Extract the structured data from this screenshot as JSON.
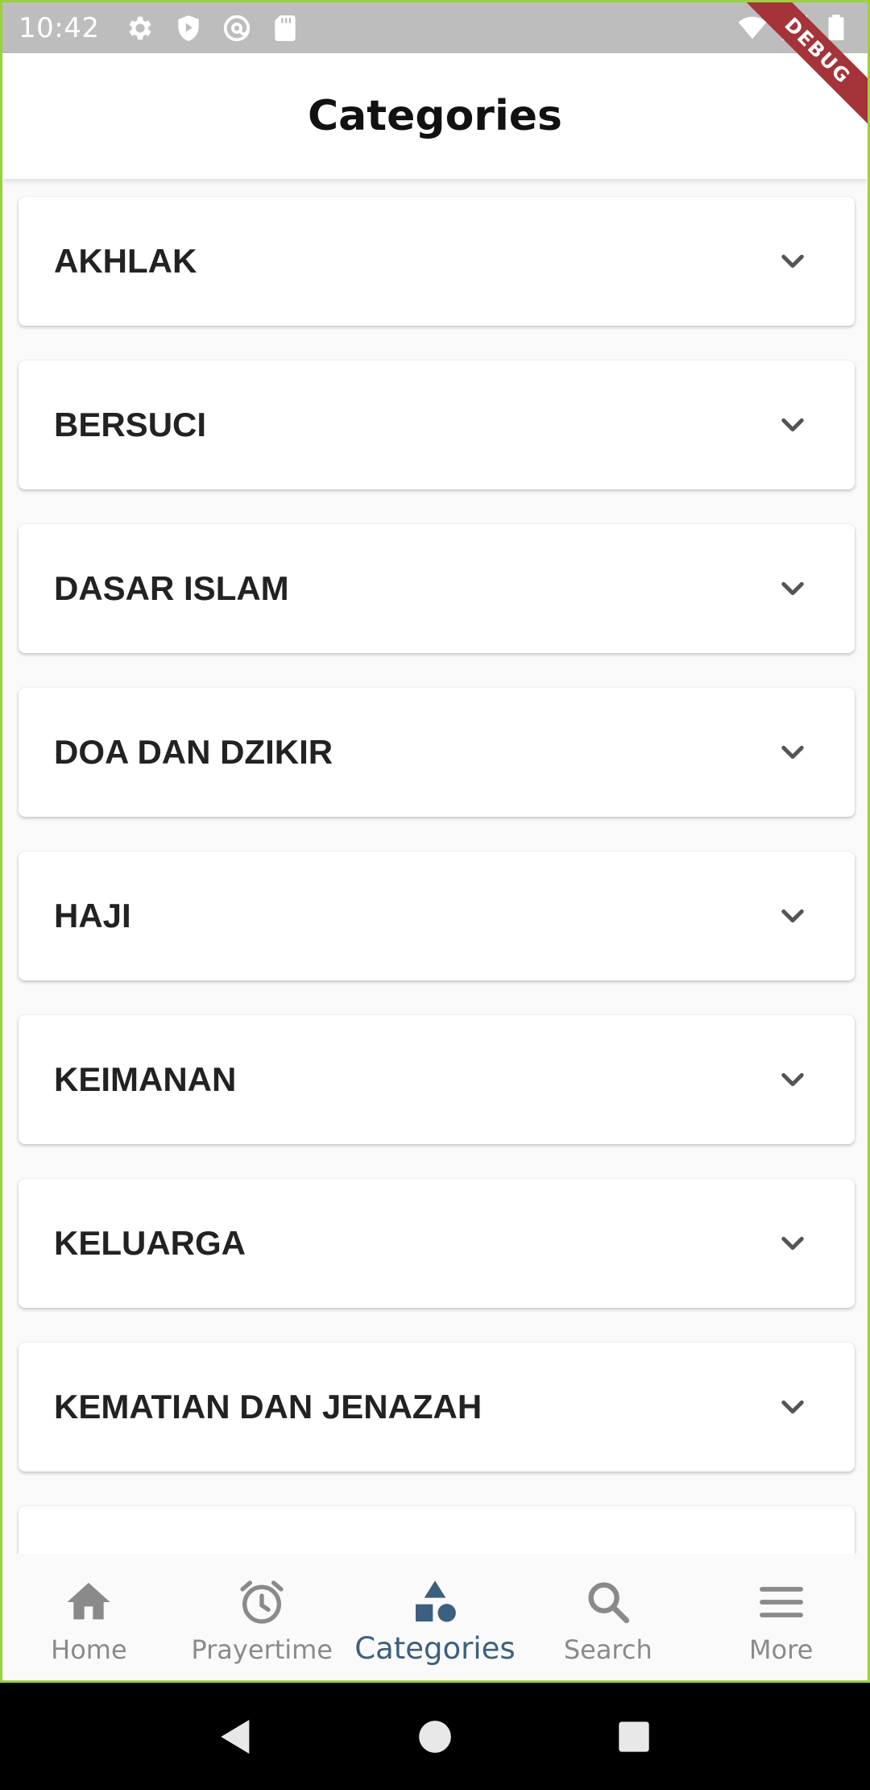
{
  "status_bar": {
    "time": "10:42",
    "icons": [
      "settings-icon",
      "shield-play-icon",
      "at-sync-icon",
      "sd-card-icon",
      "wifi-icon",
      "cell-signal-icon",
      "battery-icon"
    ]
  },
  "debug_banner": "DEBUG",
  "app_bar": {
    "title": "Categories"
  },
  "categories": [
    {
      "label": "AKHLAK"
    },
    {
      "label": "BERSUCI"
    },
    {
      "label": "DASAR ISLAM"
    },
    {
      "label": "DOA DAN DZIKIR"
    },
    {
      "label": "HAJI"
    },
    {
      "label": "KEIMANAN"
    },
    {
      "label": "KELUARGA"
    },
    {
      "label": "KEMATIAN DAN JENAZAH"
    },
    {
      "label": ""
    }
  ],
  "bottom_nav": {
    "items": [
      {
        "label": "Home",
        "icon": "home-icon"
      },
      {
        "label": "Prayertime",
        "icon": "alarm-clock-icon"
      },
      {
        "label": "Categories",
        "icon": "shapes-icon"
      },
      {
        "label": "Search",
        "icon": "search-icon"
      },
      {
        "label": "More",
        "icon": "menu-icon"
      }
    ],
    "active": "Categories"
  },
  "colors": {
    "active_nav": "#3d5f80",
    "inactive_nav": "#8a8a8a",
    "debug_ribbon": "#a4343a",
    "device_border": "#9bd13a"
  }
}
